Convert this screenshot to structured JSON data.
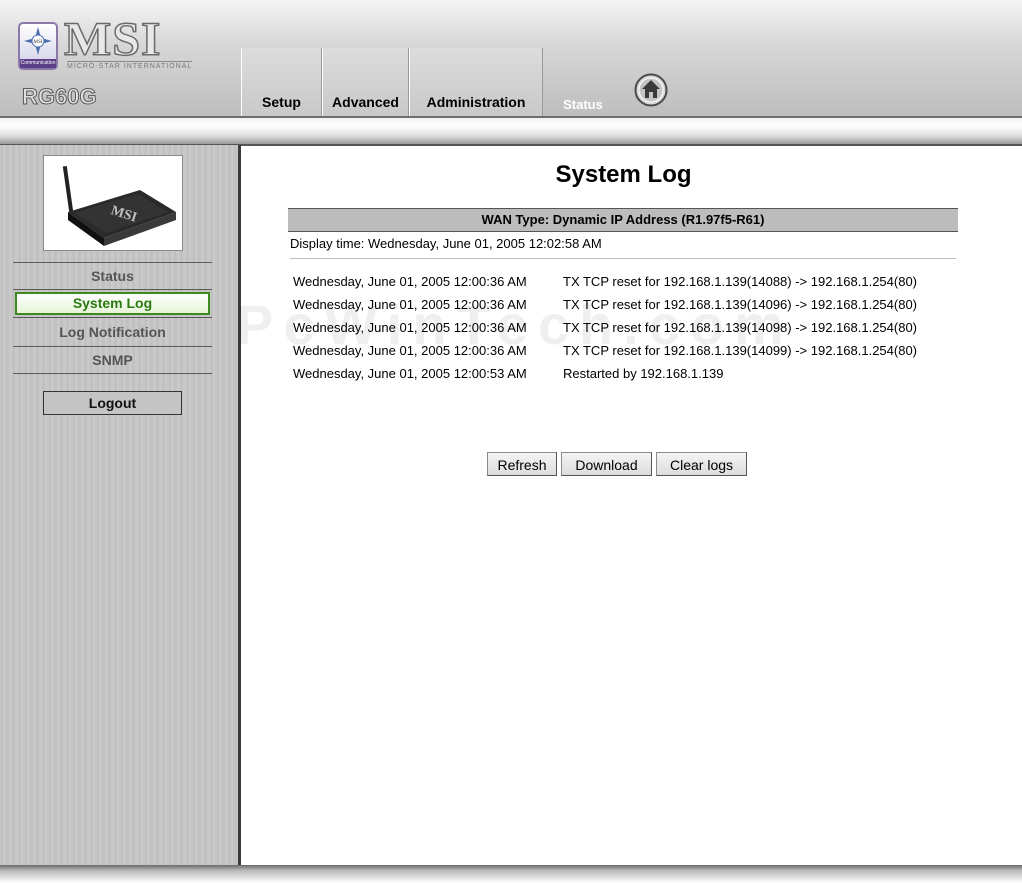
{
  "header": {
    "brand": "MSI",
    "brand_subtitle": "MICRO-STAR INTERNATIONAL",
    "emblem_caption": "Communication",
    "model": "RG60G"
  },
  "nav": {
    "tabs": [
      {
        "label": "Setup"
      },
      {
        "label": "Advanced"
      },
      {
        "label": "Administration"
      },
      {
        "label": "Status",
        "active": true
      }
    ],
    "home_icon": "home-icon"
  },
  "sidebar": {
    "items": [
      {
        "label": "Status"
      },
      {
        "label": "System Log",
        "active": true
      },
      {
        "label": "Log Notification"
      },
      {
        "label": "SNMP"
      }
    ],
    "logout_label": "Logout"
  },
  "main": {
    "title": "System Log",
    "wan_type": "WAN Type: Dynamic IP Address (R1.97f5-R61)",
    "display_time": "Display time: Wednesday, June 01, 2005 12:02:58 AM",
    "log_entries": [
      {
        "time": "Wednesday, June 01, 2005 12:00:36 AM",
        "message": "TX TCP reset for 192.168.1.139(14088) -> 192.168.1.254(80)"
      },
      {
        "time": "Wednesday, June 01, 2005 12:00:36 AM",
        "message": "TX TCP reset for 192.168.1.139(14096) -> 192.168.1.254(80)"
      },
      {
        "time": "Wednesday, June 01, 2005 12:00:36 AM",
        "message": "TX TCP reset for 192.168.1.139(14098) -> 192.168.1.254(80)"
      },
      {
        "time": "Wednesday, June 01, 2005 12:00:36 AM",
        "message": "TX TCP reset for 192.168.1.139(14099) -> 192.168.1.254(80)"
      },
      {
        "time": "Wednesday, June 01, 2005 12:00:53 AM",
        "message": "Restarted by 192.168.1.139"
      }
    ],
    "buttons": {
      "refresh": "Refresh",
      "download": "Download",
      "clear": "Clear logs"
    },
    "watermark": "PcWinTech.com"
  },
  "colors": {
    "active_green": "#3f8a1f",
    "bar_gray": "#bcbcbc"
  }
}
